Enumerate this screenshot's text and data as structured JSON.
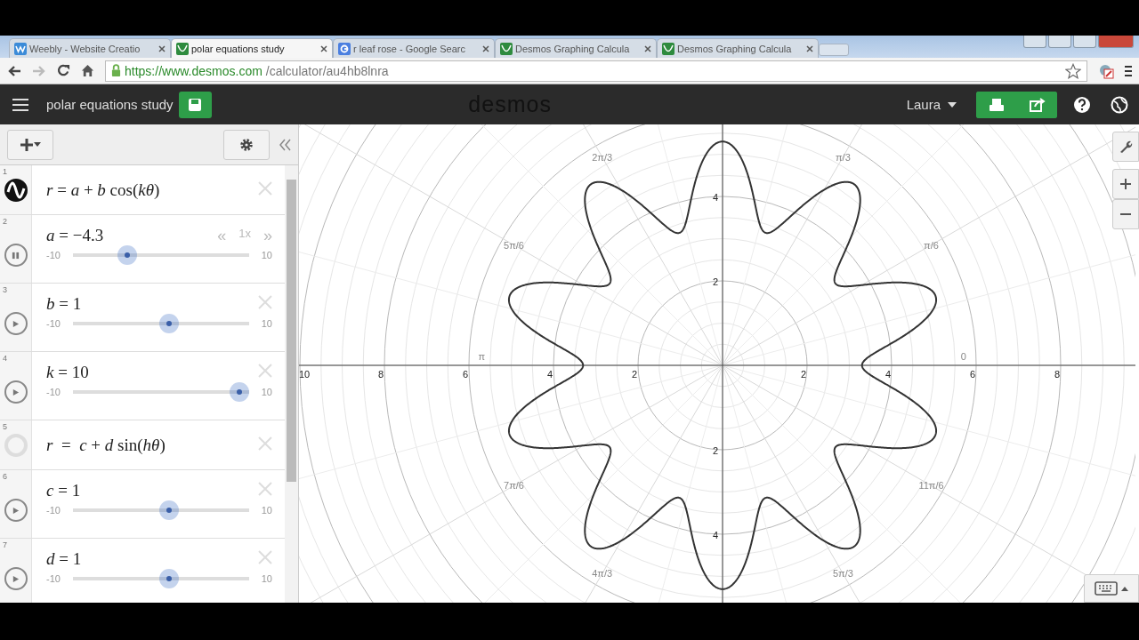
{
  "browser": {
    "tabs": [
      {
        "title": "Weebly - Website Creatio",
        "selected": false
      },
      {
        "title": "polar equations study",
        "selected": true
      },
      {
        "title": "r leaf rose - Google Searc",
        "selected": false
      },
      {
        "title": "Desmos Graphing Calcula",
        "selected": false
      },
      {
        "title": "Desmos Graphing Calcula",
        "selected": false
      }
    ],
    "url_host": "https://www.desmos.com",
    "url_path": "/calculator/au4hb8lnra"
  },
  "header": {
    "title": "polar equations study",
    "logo": "desmos",
    "user": "Laura"
  },
  "expressions": [
    {
      "number": "1",
      "kind": "expression",
      "visible": true,
      "latex": "*r* = *a* + *b* cos(*kθ*)"
    },
    {
      "number": "2",
      "kind": "slider",
      "playing": true,
      "latex": "*a* = −4.3",
      "min": "-10",
      "max": "10",
      "level": 0.285,
      "speed": {
        "slower": "«",
        "rate": "1x",
        "faster": "»"
      }
    },
    {
      "number": "3",
      "kind": "slider",
      "playing": false,
      "latex": "*b* = 1",
      "min": "-10",
      "max": "10",
      "level": 0.55
    },
    {
      "number": "4",
      "kind": "slider",
      "playing": false,
      "latex": "*k* = 10",
      "min": "-10",
      "max": "10",
      "level": 1
    },
    {
      "number": "5",
      "kind": "expression",
      "visible": false,
      "latex": "*r*  =  *c* + *d* sin(*hθ*)"
    },
    {
      "number": "6",
      "kind": "slider",
      "playing": false,
      "latex": "*c* = 1",
      "min": "-10",
      "max": "10",
      "level": 0.55
    },
    {
      "number": "7",
      "kind": "slider",
      "playing": false,
      "latex": "*d* = 1",
      "min": "-10",
      "max": "10",
      "level": 0.55
    }
  ],
  "graph": {
    "x_labels": [
      "10",
      "8",
      "6",
      "4",
      "2",
      "2",
      "4",
      "6",
      "8"
    ],
    "y_labels": [
      "4",
      "2",
      "2",
      "4"
    ],
    "angle_labels": [
      "2π/3",
      "π/3",
      "5π/6",
      "π/6",
      "π",
      "0",
      "7π/6",
      "11π/6",
      "4π/3",
      "5π/3"
    ]
  }
}
